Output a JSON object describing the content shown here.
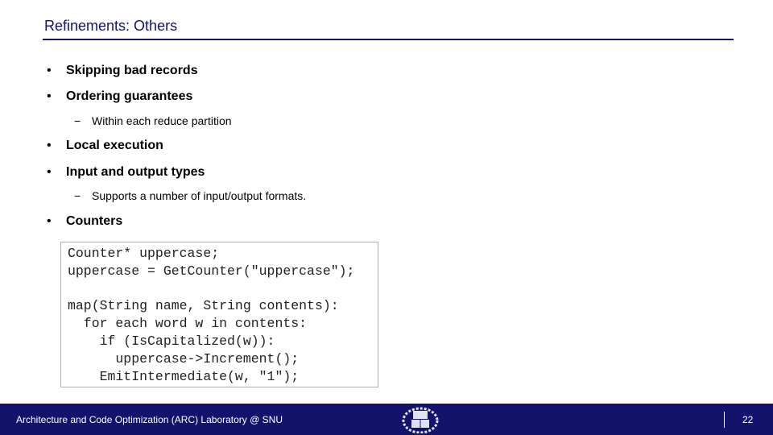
{
  "header": {
    "title": "Refinements: Others"
  },
  "bullets": [
    {
      "marker": "•",
      "text": "Skipping bad records"
    },
    {
      "marker": "•",
      "text": "Ordering guarantees",
      "sub": {
        "marker": "−",
        "text": "Within each reduce partition"
      }
    },
    {
      "marker": "•",
      "text": "Local execution"
    },
    {
      "marker": "•",
      "text": "Input and output types",
      "sub": {
        "marker": "−",
        "text": "Supports a number of input/output formats."
      }
    },
    {
      "marker": "•",
      "text": "Counters"
    }
  ],
  "code": "Counter* uppercase;\nuppercase = GetCounter(\"uppercase\");\n\nmap(String name, String contents):\n  for each word w in contents:\n    if (IsCapitalized(w)):\n      uppercase->Increment();\n    EmitIntermediate(w, \"1\");",
  "footer": {
    "lab": "Architecture and Code Optimization (ARC) Laboratory @ SNU",
    "page": "22",
    "logo": "snu-emblem-icon",
    "color": "#13136b"
  }
}
